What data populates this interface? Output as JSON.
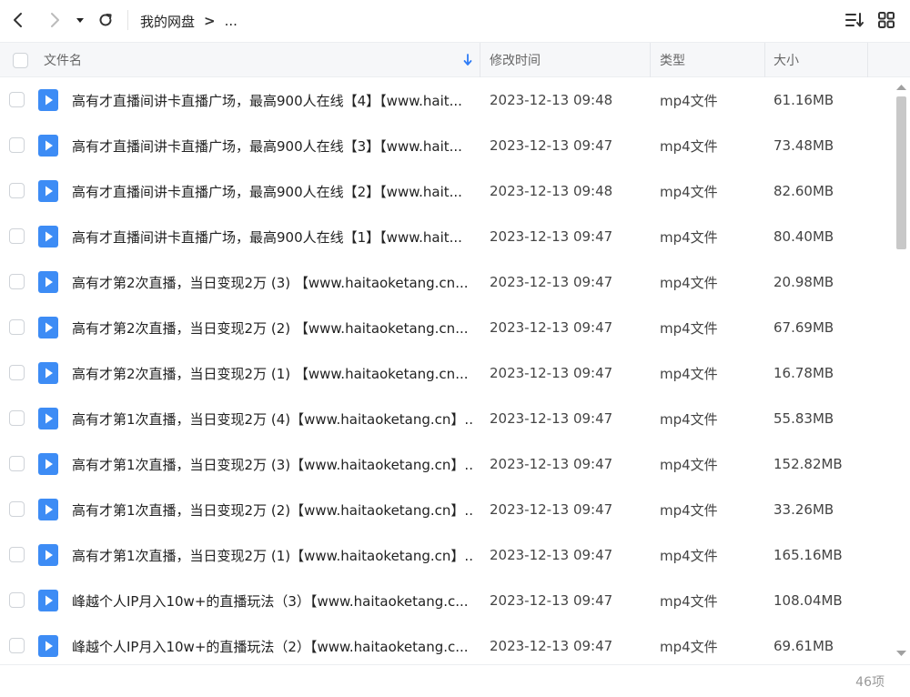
{
  "toolbar": {
    "back_icon": "chevron-left-icon",
    "forward_icon": "chevron-right-icon",
    "dropdown_icon": "caret-down-icon",
    "refresh_icon": "refresh-icon",
    "sort_icon": "sort-list-icon",
    "grid_icon": "grid-view-icon"
  },
  "breadcrumb": {
    "root": "我的网盘",
    "separator": ">",
    "current": "..."
  },
  "columns": {
    "name": "文件名",
    "modified": "修改时间",
    "type": "类型",
    "size": "大小"
  },
  "colors": {
    "file_icon": "#3d8cf5",
    "header_bg": "#f6f7f9",
    "sort_arrow": "#2f7cf6"
  },
  "files": [
    {
      "name": "高有才直播间讲卡直播广场，最高900人在线【4】【www.hait...",
      "time": "2023-12-13 09:48",
      "type": "mp4文件",
      "size": "61.16MB"
    },
    {
      "name": "高有才直播间讲卡直播广场，最高900人在线【3】【www.hait...",
      "time": "2023-12-13 09:47",
      "type": "mp4文件",
      "size": "73.48MB"
    },
    {
      "name": "高有才直播间讲卡直播广场，最高900人在线【2】【www.hait...",
      "time": "2023-12-13 09:48",
      "type": "mp4文件",
      "size": "82.60MB"
    },
    {
      "name": "高有才直播间讲卡直播广场，最高900人在线【1】【www.hait...",
      "time": "2023-12-13 09:47",
      "type": "mp4文件",
      "size": "80.40MB"
    },
    {
      "name": "高有才第2次直播，当日变现2万 (3) 【www.haitaoketang.cn...",
      "time": "2023-12-13 09:47",
      "type": "mp4文件",
      "size": "20.98MB"
    },
    {
      "name": "高有才第2次直播，当日变现2万 (2) 【www.haitaoketang.cn...",
      "time": "2023-12-13 09:47",
      "type": "mp4文件",
      "size": "67.69MB"
    },
    {
      "name": "高有才第2次直播，当日变现2万 (1) 【www.haitaoketang.cn...",
      "time": "2023-12-13 09:47",
      "type": "mp4文件",
      "size": "16.78MB"
    },
    {
      "name": "高有才第1次直播，当日变现2万 (4)【www.haitaoketang.cn】...",
      "time": "2023-12-13 09:47",
      "type": "mp4文件",
      "size": "55.83MB"
    },
    {
      "name": "高有才第1次直播，当日变现2万 (3)【www.haitaoketang.cn】...",
      "time": "2023-12-13 09:47",
      "type": "mp4文件",
      "size": "152.82MB"
    },
    {
      "name": "高有才第1次直播，当日变现2万 (2)【www.haitaoketang.cn】...",
      "time": "2023-12-13 09:47",
      "type": "mp4文件",
      "size": "33.26MB"
    },
    {
      "name": "高有才第1次直播，当日变现2万 (1)【www.haitaoketang.cn】...",
      "time": "2023-12-13 09:47",
      "type": "mp4文件",
      "size": "165.16MB"
    },
    {
      "name": "峰越个人IP月入10w+的直播玩法（3）【www.haitaoketang.c...",
      "time": "2023-12-13 09:47",
      "type": "mp4文件",
      "size": "108.04MB"
    },
    {
      "name": "峰越个人IP月入10w+的直播玩法（2）【www.haitaoketang.c...",
      "time": "2023-12-13 09:47",
      "type": "mp4文件",
      "size": "69.61MB"
    }
  ],
  "footer": {
    "count": "46项"
  }
}
